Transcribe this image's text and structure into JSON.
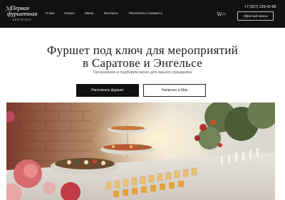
{
  "header": {
    "logo": {
      "mark": "ℳ",
      "line1": "Первая",
      "line2": "фуршетная",
      "sub": "КЕЙТЕРИНГ"
    },
    "nav": [
      "О нас",
      "Услуги",
      "Меню",
      "Контакты",
      "Рассчитать стоимость"
    ],
    "phone": "+7 (927) 129-42-88",
    "cart": {
      "icon": "cart-icon",
      "count": "(0)"
    },
    "callback_label": "Обратный звонок"
  },
  "hero": {
    "title_line1": "Фуршет под ключ для мероприятий",
    "title_line2": "в Саратове и Энгельсе",
    "subtitle": "Организуем и подберем меню для вашего праздника",
    "primary_button": "Рассчитать фуршет",
    "secondary_button": "Написать в Max"
  },
  "colors": {
    "header_bg": "#111111",
    "text": "#1a1a1a",
    "button_dark": "#111111"
  }
}
